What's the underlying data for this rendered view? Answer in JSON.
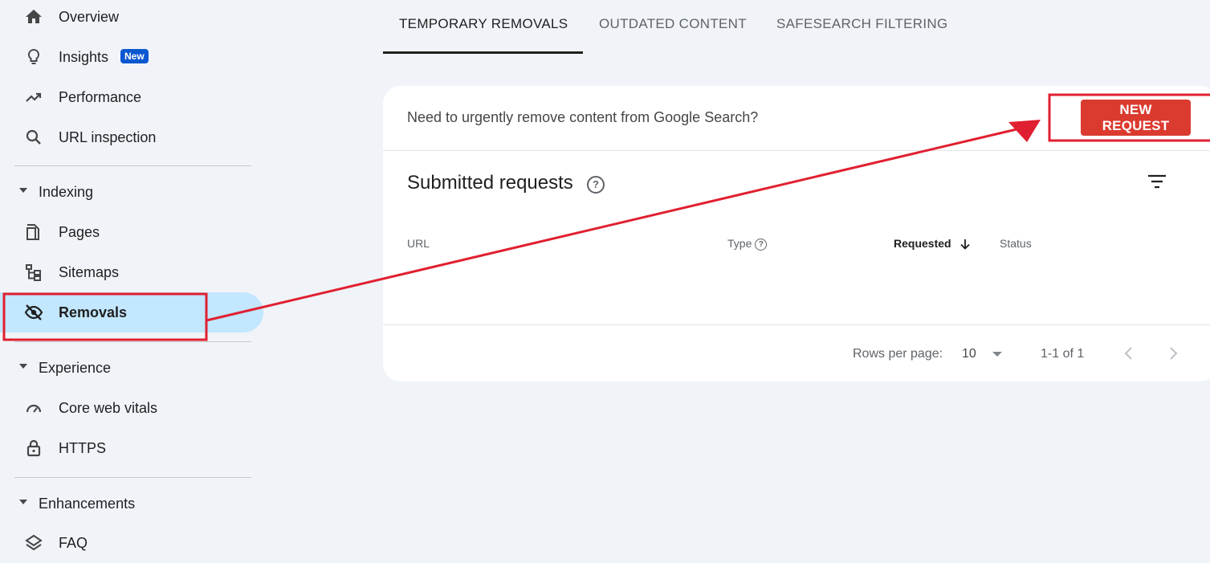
{
  "sidebar": {
    "items": [
      {
        "label": "Overview",
        "icon": "home-icon"
      },
      {
        "label": "Insights",
        "icon": "lightbulb-icon",
        "badge": "New"
      },
      {
        "label": "Performance",
        "icon": "trending-up-icon"
      },
      {
        "label": "URL inspection",
        "icon": "search-icon"
      }
    ],
    "sections": [
      {
        "label": "Indexing"
      },
      {
        "label": "Experience"
      },
      {
        "label": "Enhancements"
      }
    ],
    "indexing_items": [
      {
        "label": "Pages",
        "icon": "pages-icon"
      },
      {
        "label": "Sitemaps",
        "icon": "sitemap-icon"
      },
      {
        "label": "Removals",
        "icon": "eye-off-icon",
        "active": true
      }
    ],
    "experience_items": [
      {
        "label": "Core web vitals",
        "icon": "speedometer-icon"
      },
      {
        "label": "HTTPS",
        "icon": "lock-icon"
      }
    ],
    "enhancement_items": [
      {
        "label": "FAQ",
        "icon": "layers-icon"
      }
    ]
  },
  "tabs": [
    {
      "label": "TEMPORARY REMOVALS",
      "active": true
    },
    {
      "label": "OUTDATED CONTENT"
    },
    {
      "label": "SAFESEARCH FILTERING"
    }
  ],
  "card": {
    "prompt": "Need to urgently remove content from Google Search?",
    "new_request_label": "NEW REQUEST",
    "title": "Submitted requests",
    "columns": {
      "url": "URL",
      "type": "Type",
      "requested": "Requested",
      "status": "Status"
    },
    "rows_per_page_label": "Rows per page:",
    "rows_per_page_value": "10",
    "range": "1-1 of 1"
  },
  "colors": {
    "accent_red": "#db3a2f",
    "active_nav": "#c2e7ff",
    "annotation": "#e02030",
    "badge": "#0b57d0"
  }
}
